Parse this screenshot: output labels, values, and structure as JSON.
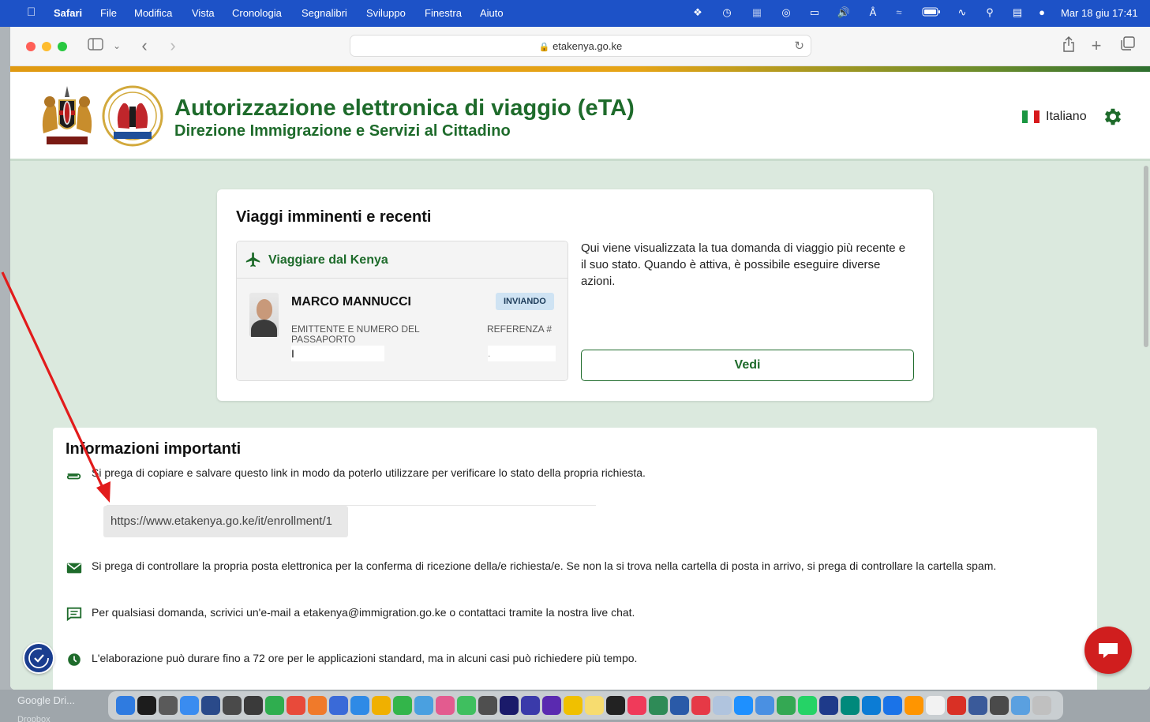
{
  "menubar": {
    "app": "Safari",
    "items": [
      "File",
      "Modifica",
      "Vista",
      "Cronologia",
      "Segnalibri",
      "Sviluppo",
      "Finestra",
      "Aiuto"
    ],
    "clock": "Mar 18 giu  17:41"
  },
  "browser": {
    "url": "etakenya.go.ke"
  },
  "site": {
    "title": "Autorizzazione elettronica di viaggio (eTA)",
    "subtitle": "Direzione Immigrazione e Servizi al Cittadino",
    "language": "Italiano",
    "colors": {
      "brand_green": "#1e6b2b",
      "content_bg": "#dbe9de"
    }
  },
  "trips": {
    "heading": "Viaggi imminenti e recenti",
    "trip_type": "Viaggiare dal Kenya",
    "name": "MARCO MANNUCCI",
    "status": "INVIANDO",
    "issuer_label": "EMITTENTE E NUMERO DEL PASSAPORTO",
    "issuer_value": "I",
    "reference_label": "REFERENZA #",
    "reference_value": ".",
    "description": "Qui viene visualizzata la tua domanda di viaggio più recente e il suo stato. Quando è attiva, è possibile eseguire diverse azioni.",
    "view_button": "Vedi"
  },
  "info": {
    "heading": "Informazioni importanti",
    "link_note": "Si prega di copiare e salvare questo link in modo da poterlo utilizzare per verificare lo stato della propria richiesta.",
    "link_url": "https://www.etakenya.go.ke/it/enrollment/1",
    "email_note": "Si prega di controllare la propria posta elettronica per la conferma di ricezione della/e richiesta/e. Se non la si trova nella cartella di posta in arrivo, si prega di controllare la cartella spam.",
    "contact_note": "Per qualsiasi domanda, scrivici un'e-mail a etakenya@immigration.go.ke o contattaci tramite la nostra live chat.",
    "time_note": "L'elaborazione può durare fino a 72 ore per le applicazioni standard, ma in alcuni casi può richiedere più tempo."
  },
  "dock": {
    "sidebar_items": [
      "Google Dri...",
      "Dropbox"
    ]
  }
}
